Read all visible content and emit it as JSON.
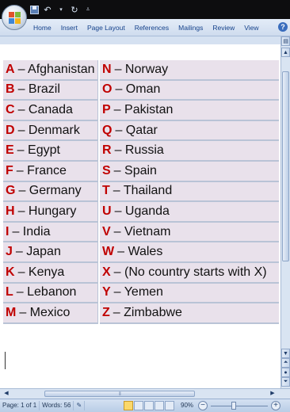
{
  "ribbon": {
    "tabs": [
      "Home",
      "Insert",
      "Page Layout",
      "References",
      "Mailings",
      "Review",
      "View"
    ],
    "help_label": "?"
  },
  "table": {
    "rows": [
      {
        "l1": "A",
        "n1": "– Afghanistan",
        "l2": "N",
        "n2": "– Norway"
      },
      {
        "l1": "B",
        "n1": "– Brazil",
        "l2": "O",
        "n2": "– Oman"
      },
      {
        "l1": "C",
        "n1": "– Canada",
        "l2": "P",
        "n2": "– Pakistan"
      },
      {
        "l1": "D",
        "n1": "– Denmark",
        "l2": "Q",
        "n2": "– Qatar"
      },
      {
        "l1": "E",
        "n1": "– Egypt",
        "l2": "R",
        "n2": "– Russia"
      },
      {
        "l1": "F",
        "n1": "– France",
        "l2": "S",
        "n2": "– Spain"
      },
      {
        "l1": "G",
        "n1": "– Germany",
        "l2": "T",
        "n2": "– Thailand"
      },
      {
        "l1": "H",
        "n1": "– Hungary",
        "l2": "U",
        "n2": "– Uganda"
      },
      {
        "l1": "I",
        "n1": "– India",
        "l2": "V",
        "n2": "– Vietnam"
      },
      {
        "l1": "J",
        "n1": "– Japan",
        "l2": "W",
        "n2": "– Wales"
      },
      {
        "l1": "K",
        "n1": "– Kenya",
        "l2": "X",
        "n2": "– (No country starts with X)"
      },
      {
        "l1": "L",
        "n1": "– Lebanon",
        "l2": "Y",
        "n2": "– Yemen"
      },
      {
        "l1": "M",
        "n1": "– Mexico",
        "l2": "Z",
        "n2": "– Zimbabwe"
      }
    ],
    "letter_color": "#c00000"
  },
  "status": {
    "page": "Page: 1 of 1",
    "words": "Words: 56",
    "zoom": "90%"
  },
  "colors": {
    "title_bar": "#0d0d0f",
    "cell_bg": "#e9e1eb",
    "tab_text": "#15428b"
  }
}
